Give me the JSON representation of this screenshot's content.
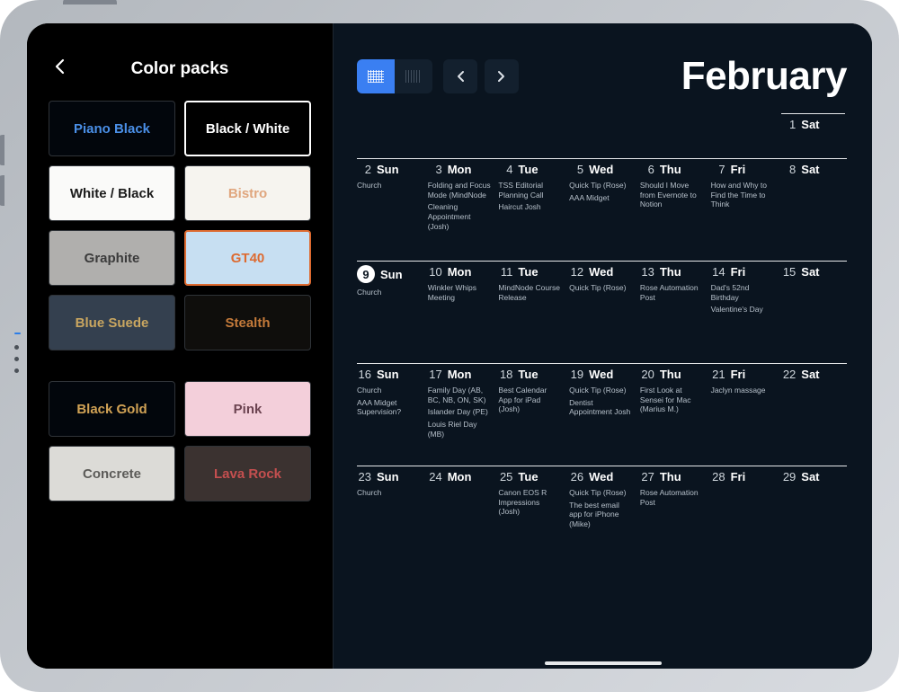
{
  "sidebar": {
    "title": "Color packs",
    "packs": [
      {
        "label": "Piano Black"
      },
      {
        "label": "Black / White"
      },
      {
        "label": "White / Black"
      },
      {
        "label": "Bistro"
      },
      {
        "label": "Graphite"
      },
      {
        "label": "GT40"
      },
      {
        "label": "Blue Suede"
      },
      {
        "label": "Stealth"
      },
      {
        "label": "Black Gold"
      },
      {
        "label": "Pink"
      },
      {
        "label": "Concrete"
      },
      {
        "label": "Lava Rock"
      }
    ]
  },
  "header": {
    "month": "February"
  },
  "weeks": [
    {
      "days": [
        {
          "num": "1",
          "name": "Sat",
          "events": []
        }
      ]
    },
    {
      "days": [
        {
          "num": "2",
          "name": "Sun",
          "events": [
            "Church"
          ]
        },
        {
          "num": "3",
          "name": "Mon",
          "events": [
            "Folding and Focus Mode (MindNode",
            "Cleaning Appointment (Josh)"
          ]
        },
        {
          "num": "4",
          "name": "Tue",
          "events": [
            "TSS Editorial Planning Call",
            "Haircut Josh"
          ]
        },
        {
          "num": "5",
          "name": "Wed",
          "events": [
            "Quick Tip (Rose)",
            "AAA Midget"
          ]
        },
        {
          "num": "6",
          "name": "Thu",
          "events": [
            "Should I Move from Evernote to Notion"
          ]
        },
        {
          "num": "7",
          "name": "Fri",
          "events": [
            "How and Why to Find the Time to Think"
          ]
        },
        {
          "num": "8",
          "name": "Sat",
          "events": []
        }
      ]
    },
    {
      "days": [
        {
          "num": "9",
          "name": "Sun",
          "today": true,
          "events": [
            "Church"
          ]
        },
        {
          "num": "10",
          "name": "Mon",
          "events": [
            "Winkler Whips Meeting"
          ]
        },
        {
          "num": "11",
          "name": "Tue",
          "events": [
            "MindNode Course Release"
          ]
        },
        {
          "num": "12",
          "name": "Wed",
          "events": [
            "Quick Tip (Rose)"
          ]
        },
        {
          "num": "13",
          "name": "Thu",
          "events": [
            "Rose Automation Post"
          ]
        },
        {
          "num": "14",
          "name": "Fri",
          "events": [
            "Dad's 52nd Birthday",
            "Valentine's Day"
          ]
        },
        {
          "num": "15",
          "name": "Sat",
          "events": []
        }
      ]
    },
    {
      "days": [
        {
          "num": "16",
          "name": "Sun",
          "events": [
            "Church",
            "AAA Midget Supervision?"
          ]
        },
        {
          "num": "17",
          "name": "Mon",
          "events": [
            "Family Day (AB, BC, NB, ON, SK)",
            "Islander Day (PE)",
            "Louis Riel Day (MB)"
          ]
        },
        {
          "num": "18",
          "name": "Tue",
          "events": [
            "Best Calendar App for iPad (Josh)"
          ]
        },
        {
          "num": "19",
          "name": "Wed",
          "events": [
            "Quick Tip (Rose)",
            "Dentist Appointment Josh"
          ]
        },
        {
          "num": "20",
          "name": "Thu",
          "events": [
            "First Look at Sensei for Mac (Marius M.)"
          ]
        },
        {
          "num": "21",
          "name": "Fri",
          "events": [
            "Jaclyn massage"
          ]
        },
        {
          "num": "22",
          "name": "Sat",
          "events": []
        }
      ]
    },
    {
      "days": [
        {
          "num": "23",
          "name": "Sun",
          "events": [
            "Church"
          ]
        },
        {
          "num": "24",
          "name": "Mon",
          "events": []
        },
        {
          "num": "25",
          "name": "Tue",
          "events": [
            "Canon EOS R Impressions (Josh)"
          ]
        },
        {
          "num": "26",
          "name": "Wed",
          "events": [
            "Quick Tip (Rose)",
            "The best email app for iPhone (Mike)"
          ]
        },
        {
          "num": "27",
          "name": "Thu",
          "events": [
            "Rose Automation Post"
          ]
        },
        {
          "num": "28",
          "name": "Fri",
          "events": []
        },
        {
          "num": "29",
          "name": "Sat",
          "events": []
        }
      ]
    }
  ]
}
